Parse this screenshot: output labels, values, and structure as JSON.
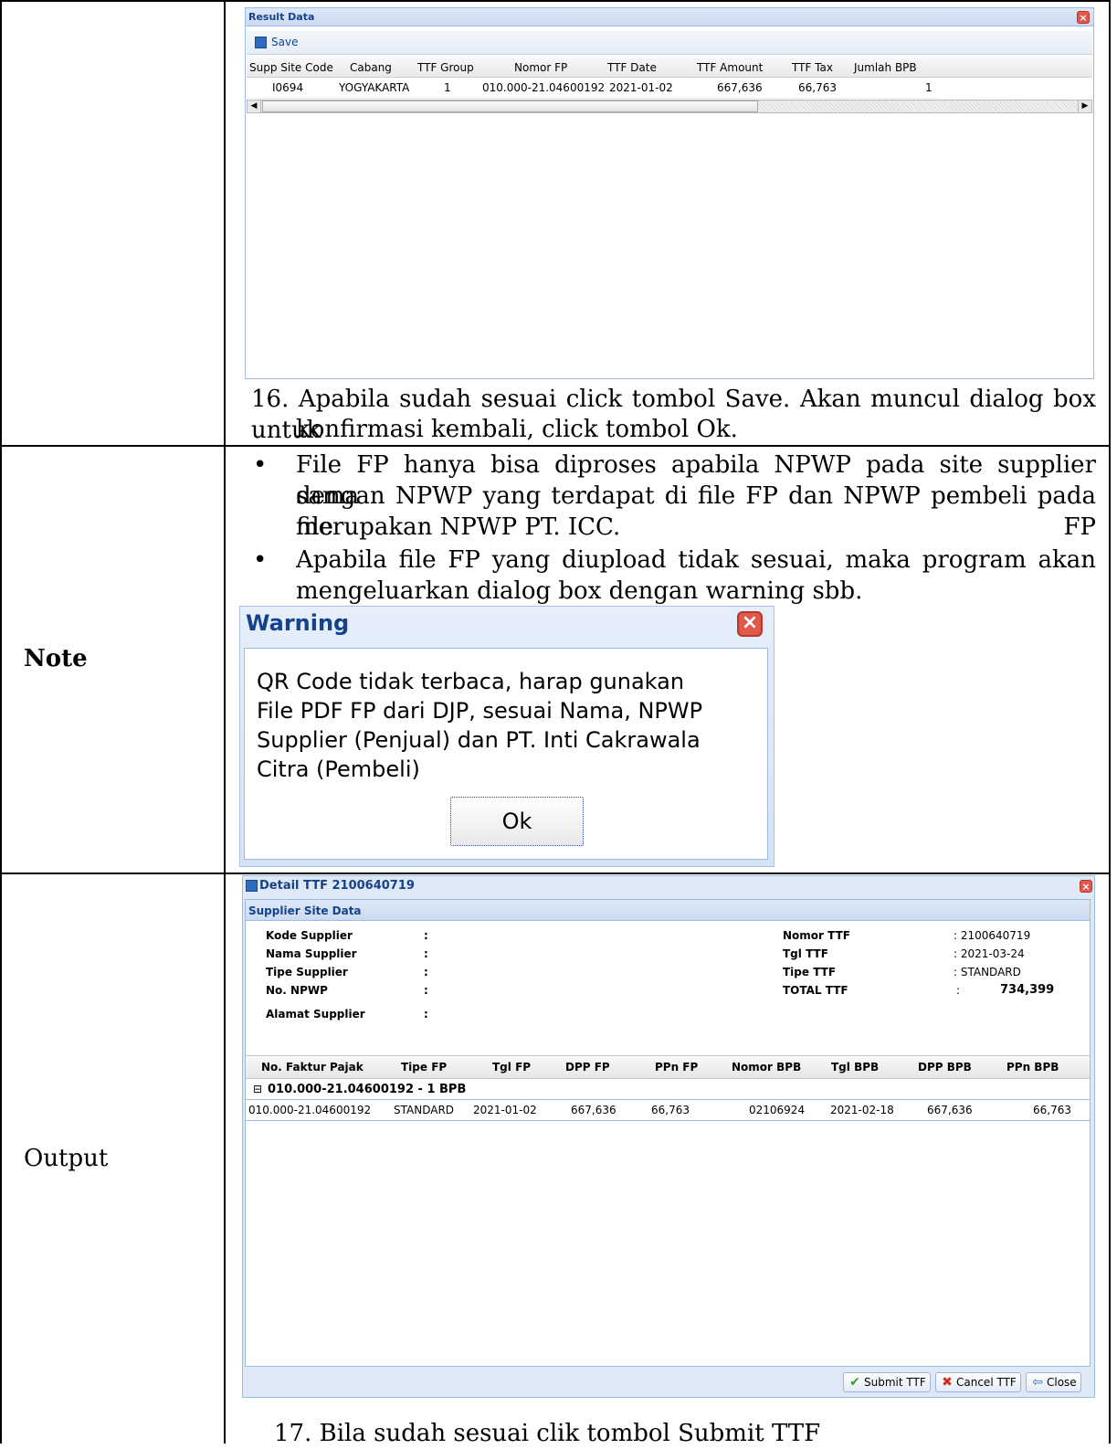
{
  "result_panel": {
    "title": "Result Data",
    "save_label": "Save",
    "columns": [
      "Supp Site Code",
      "Cabang",
      "TTF Group",
      "Nomor FP",
      "TTF Date",
      "TTF Amount",
      "TTF Tax",
      "Jumlah BPB"
    ],
    "row": [
      "I0694",
      "YOGYAKARTA",
      "1",
      "010.000-21.04600192",
      "2021-01-02",
      "667,636",
      "66,763",
      "1"
    ]
  },
  "step16": {
    "line1": "16. Apabila sudah sesuai click tombol Save. Akan muncul dialog box untuk",
    "line2": "konfirmasi kembali, click tombol Ok."
  },
  "note": {
    "label": "Note",
    "bullet1_l1": "File FP hanya bisa diproses apabila NPWP pada site supplier sama",
    "bullet1_l2": "dengan NPWP yang terdapat di file FP dan NPWP pembeli pada file FP",
    "bullet1_l3": "merupakan NPWP PT. ICC.",
    "bullet2_l1": "Apabila file FP yang diupload tidak sesuai, maka program akan",
    "bullet2_l2": "mengeluarkan dialog box dengan warning sbb."
  },
  "warning": {
    "title": "Warning",
    "line1": "QR Code tidak terbaca, harap gunakan",
    "line2": "File PDF FP dari DJP, sesuai Nama, NPWP",
    "line3": "Supplier (Penjual) dan PT. Inti Cakrawala",
    "line4": "Citra (Pembeli)",
    "ok": "Ok"
  },
  "output": {
    "label": "Output",
    "window_title": "Detail TTF 2100640719",
    "section_title": "Supplier Site Data",
    "left_fields": [
      {
        "label": "Kode Supplier",
        "value": ":"
      },
      {
        "label": "Nama Supplier",
        "value": ":"
      },
      {
        "label": "Tipe Supplier",
        "value": ":"
      },
      {
        "label": "No. NPWP",
        "value": ":"
      },
      {
        "label": "Alamat Supplier",
        "value": ":"
      }
    ],
    "right_fields": [
      {
        "label": "Nomor TTF",
        "value": ": 2100640719"
      },
      {
        "label": "Tgl TTF",
        "value": ": 2021-03-24"
      },
      {
        "label": "Tipe TTF",
        "value": ": STANDARD"
      },
      {
        "label": "TOTAL TTF",
        "value": ":",
        "amount": "734,399"
      }
    ],
    "columns": [
      "No. Faktur Pajak",
      "Tipe FP",
      "Tgl FP",
      "DPP FP",
      "PPn FP",
      "Nomor BPB",
      "Tgl BPB",
      "DPP BPB",
      "PPn BPB"
    ],
    "group_label": "010.000-21.04600192 - 1 BPB",
    "row": [
      "010.000-21.04600192",
      "STANDARD",
      "2021-01-02",
      "667,636",
      "66,763",
      "02106924",
      "2021-02-18",
      "667,636",
      "66,763"
    ],
    "buttons": {
      "submit": "Submit TTF",
      "cancel": "Cancel TTF",
      "close": "Close"
    }
  },
  "step17": "17. Bila sudah sesuai clik tombol Submit TTF"
}
